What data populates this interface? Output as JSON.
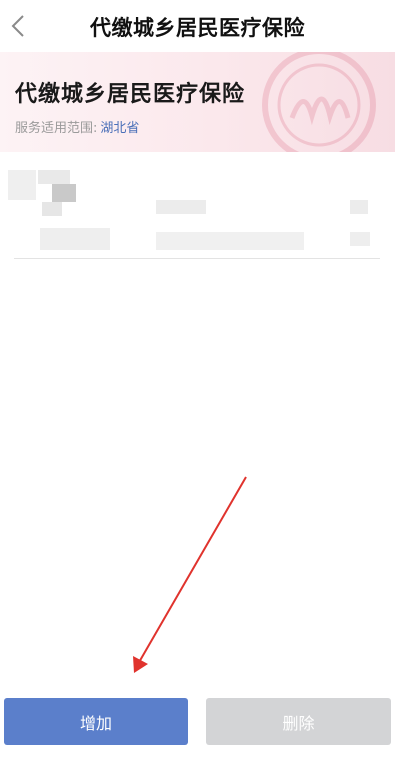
{
  "navbar": {
    "title": "代缴城乡居民医疗保险",
    "back_icon": "chevron-left-icon"
  },
  "banner": {
    "title": "代缴城乡居民医疗保险",
    "scope_label": "服务适用范围:",
    "scope_value": "湖北省",
    "seal_icon": "official-seal-watermark"
  },
  "record": {
    "blurred": true
  },
  "annotation": {
    "arrow_color": "#e0332d"
  },
  "actions": {
    "add_label": "增加",
    "delete_label": "删除",
    "add_color": "#5b7fcb",
    "delete_color": "#d3d4d6"
  }
}
